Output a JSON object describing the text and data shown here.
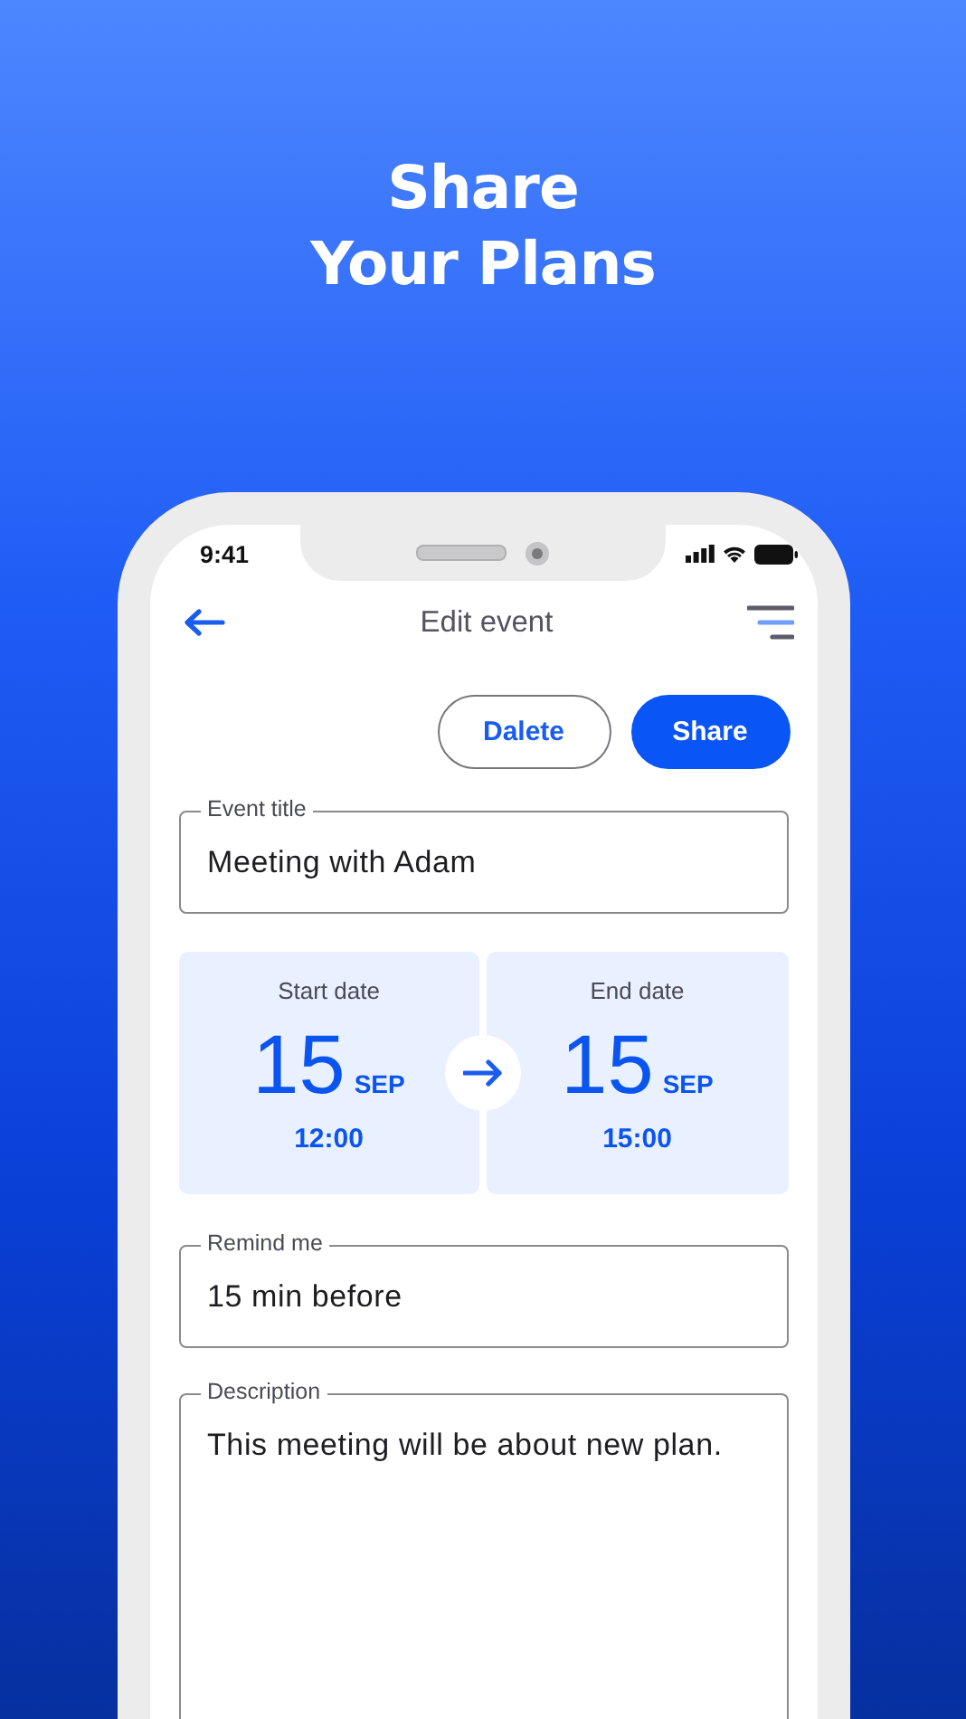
{
  "headline": [
    "Share",
    "Your Plans"
  ],
  "status_bar": {
    "time": "9:41"
  },
  "app_bar": {
    "title": "Edit event"
  },
  "actions": [
    {
      "label": "Dalete",
      "kind": "outlined"
    },
    {
      "label": "Share",
      "kind": "filled"
    }
  ],
  "event_title": {
    "label": "Event title",
    "value": "Meeting with Adam"
  },
  "dates": [
    {
      "label": "Start date",
      "day": "15",
      "month": "SEP",
      "time": "12:00"
    },
    {
      "label": "End date",
      "day": "15",
      "month": "SEP",
      "time": "15:00"
    }
  ],
  "remind": {
    "label": "Remind me",
    "value": "15 min before"
  },
  "description": {
    "label": "Description",
    "value": "This meeting will be about new plan."
  }
}
